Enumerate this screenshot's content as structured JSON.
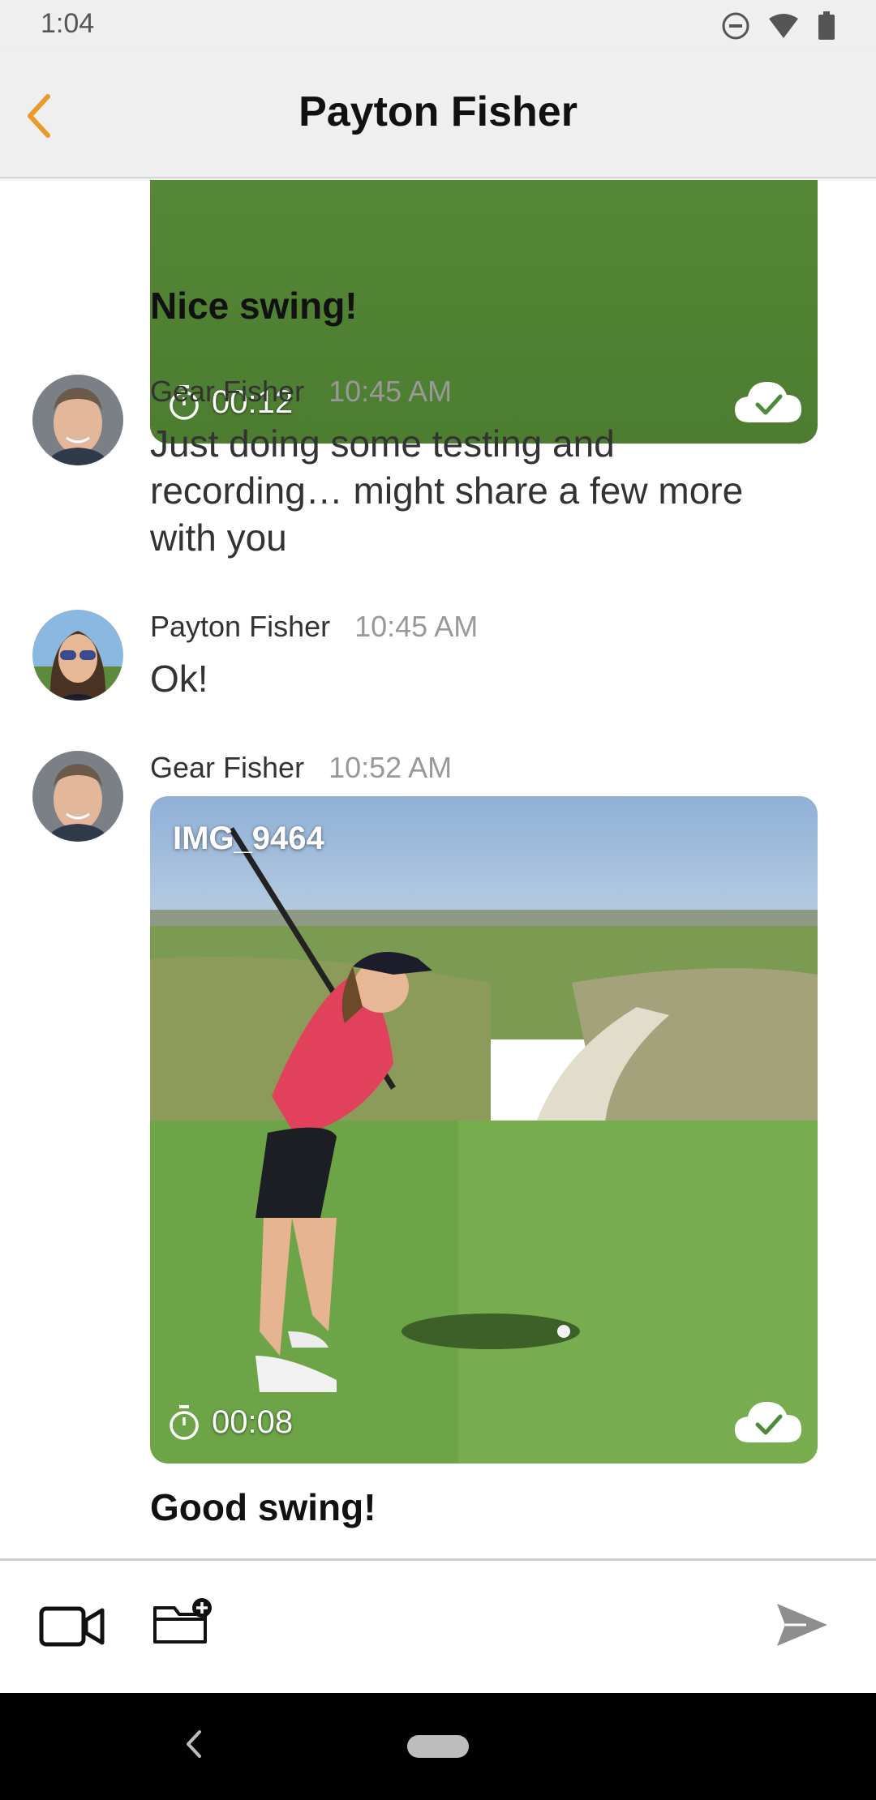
{
  "status_bar": {
    "time": "1:04"
  },
  "header": {
    "title": "Payton Fisher"
  },
  "messages": [
    {
      "type": "video",
      "duration": "00:12",
      "caption": "Nice swing!"
    },
    {
      "type": "text",
      "sender": "Gear Fisher",
      "time": "10:45 AM",
      "text": "Just doing some testing and recording… might share a few more with you"
    },
    {
      "type": "text",
      "sender": "Payton Fisher",
      "time": "10:45 AM",
      "text": "Ok!"
    },
    {
      "type": "video",
      "sender": "Gear Fisher",
      "time": "10:52 AM",
      "label": "IMG_9464",
      "duration": "00:08",
      "caption": "Good swing!"
    }
  ],
  "colors": {
    "accent": "#E89A2A",
    "header_bg": "#efefef",
    "nav_bg": "#000000"
  }
}
